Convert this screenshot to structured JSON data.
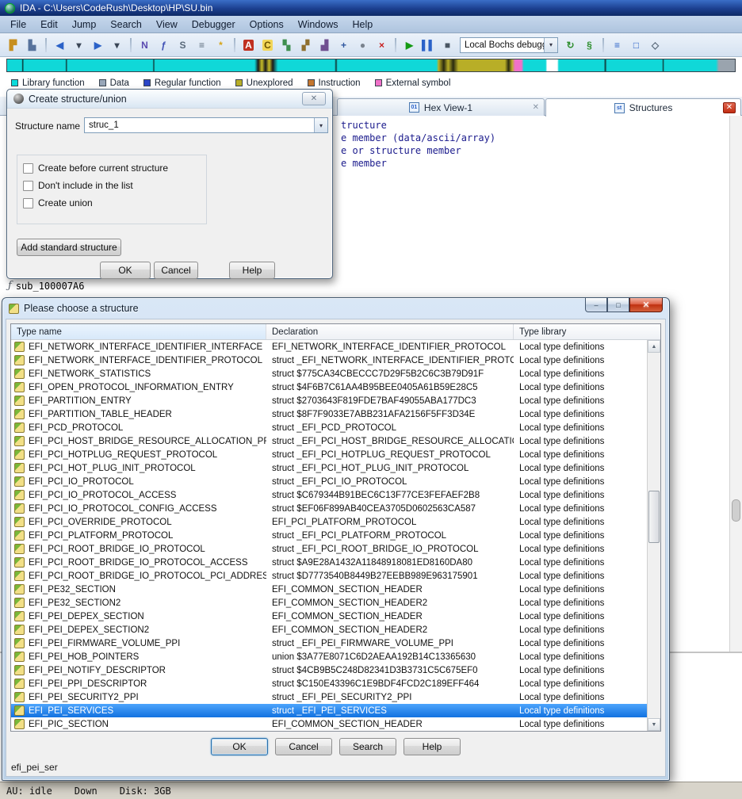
{
  "window": {
    "title": "IDA - C:\\Users\\CodeRush\\Desktop\\HP\\SU.bin"
  },
  "menubar": {
    "items": [
      "File",
      "Edit",
      "Jump",
      "Search",
      "View",
      "Debugger",
      "Options",
      "Windows",
      "Help"
    ]
  },
  "toolbar": {
    "debugger_combo": {
      "value": "Local Bochs debugger",
      "arrow": "▾"
    },
    "items_left": [
      {
        "name": "open-file-icon",
        "glyph": "▛",
        "color": "#c78f1f"
      },
      {
        "name": "save-icon",
        "glyph": "▙",
        "color": "#56729c"
      },
      {
        "name": "separator"
      },
      {
        "name": "navigate-back-icon",
        "glyph": "◀",
        "color": "#2b62c8"
      },
      {
        "name": "back-history-dropdown-icon",
        "glyph": "▾",
        "color": "#3a4656"
      },
      {
        "name": "navigate-forward-icon",
        "glyph": "▶",
        "color": "#2b62c8"
      },
      {
        "name": "forward-history-dropdown-icon",
        "glyph": "▾",
        "color": "#3a4656"
      },
      {
        "name": "separator"
      },
      {
        "name": "names-window-icon",
        "glyph": "N",
        "color": "#5a4ab0"
      },
      {
        "name": "functions-window-icon",
        "glyph": "ƒ",
        "color": "#3f51b5"
      },
      {
        "name": "strings-window-icon",
        "glyph": "S",
        "color": "#5a6a7a"
      },
      {
        "name": "segments-window-icon",
        "glyph": "≡",
        "color": "#5a6a7a"
      },
      {
        "name": "flashlight-icon",
        "glyph": "*",
        "color": "#d7a417"
      },
      {
        "name": "separator"
      },
      {
        "name": "bitmap-icon",
        "glyph": "A",
        "color": "#ffffff",
        "bg": "#c03020"
      },
      {
        "name": "compiler-icon",
        "glyph": "C",
        "color": "#6b5200",
        "bg": "#f2d659"
      },
      {
        "name": "flow-chart-icon",
        "glyph": "▚",
        "color": "#3f8f4f"
      },
      {
        "name": "graph-view-icon",
        "glyph": "▞",
        "color": "#8f6f2f"
      },
      {
        "name": "call-graph-icon",
        "glyph": "▟",
        "color": "#6f4f8f"
      },
      {
        "name": "new-window-icon",
        "glyph": "+",
        "color": "#30589f"
      },
      {
        "name": "snapshot-icon",
        "glyph": "●",
        "color": "#7a838e"
      },
      {
        "name": "delete-icon",
        "glyph": "×",
        "color": "#c81e1e"
      },
      {
        "name": "separator"
      },
      {
        "name": "start-process-icon",
        "glyph": "▶",
        "color": "#149a14"
      },
      {
        "name": "pause-process-icon",
        "glyph": "▌▌",
        "color": "#2b62c8"
      },
      {
        "name": "stop-process-icon",
        "glyph": "■",
        "color": "#4a5663"
      }
    ],
    "items_right": [
      {
        "name": "refresh-icon",
        "glyph": "↻",
        "color": "#2f8f2f"
      },
      {
        "name": "run-script-icon",
        "glyph": "§",
        "color": "#2f8f2f"
      },
      {
        "name": "separator"
      },
      {
        "name": "type-libraries-icon",
        "glyph": "≡",
        "color": "#2b62c8"
      },
      {
        "name": "structures-window-icon",
        "glyph": "□",
        "color": "#2b62c8"
      },
      {
        "name": "enums-window-icon",
        "glyph": "◇",
        "color": "#5a6a7a"
      }
    ]
  },
  "navband": {
    "legend": [
      {
        "label": "Library function",
        "color": "#0adbdb"
      },
      {
        "label": "Data",
        "color": "#98a6b8"
      },
      {
        "label": "Regular function",
        "color": "#2b46c8"
      },
      {
        "label": "Unexplored",
        "color": "#b8ae27"
      },
      {
        "label": "Instruction",
        "color": "#c4762e"
      },
      {
        "label": "External symbol",
        "color": "#f071c8"
      }
    ]
  },
  "tabs": {
    "hex": {
      "label": "Hex View-1",
      "icon_glyph": "01",
      "close_glyph": "✕"
    },
    "structures": {
      "label": "Structures",
      "icon_glyph": "st",
      "close_glyph": "✕"
    }
  },
  "structures_view": {
    "lines": [
      "tructure",
      "e member (data/ascii/array)",
      "e or structure member",
      "e member"
    ],
    "function_icon": "ƒ",
    "function_label": "sub_100007A6"
  },
  "create_dialog": {
    "title": "Create structure/union",
    "close_glyph": "✕",
    "name_label": "Structure name",
    "name_value": "struc_1",
    "name_arrow": "▾",
    "checkboxes": [
      "Create before current structure",
      "Don't include in the list",
      "Create union"
    ],
    "add_button": "Add standard structure",
    "buttons": [
      "OK",
      "Cancel",
      "Help"
    ]
  },
  "choose_dialog": {
    "title": "Please choose a structure",
    "window_buttons": {
      "minimize": "–",
      "maximize": "□",
      "close": "✕"
    },
    "columns": [
      "Type name",
      "Declaration",
      "Type library"
    ],
    "selected_index": 27,
    "rows": [
      {
        "type_name": "EFI_NETWORK_INTERFACE_IDENTIFIER_INTERFACE",
        "declaration": "EFI_NETWORK_INTERFACE_IDENTIFIER_PROTOCOL",
        "library": "Local type definitions"
      },
      {
        "type_name": "EFI_NETWORK_INTERFACE_IDENTIFIER_PROTOCOL",
        "declaration": "struct _EFI_NETWORK_INTERFACE_IDENTIFIER_PROTOC...",
        "library": "Local type definitions"
      },
      {
        "type_name": "EFI_NETWORK_STATISTICS",
        "declaration": "struct $775CA34CBECCC7D29F5B2C6C3B79D91F",
        "library": "Local type definitions"
      },
      {
        "type_name": "EFI_OPEN_PROTOCOL_INFORMATION_ENTRY",
        "declaration": "struct $4F6B7C61AA4B95BEE0405A61B59E28C5",
        "library": "Local type definitions"
      },
      {
        "type_name": "EFI_PARTITION_ENTRY",
        "declaration": "struct $2703643F819FDE7BAF49055ABA177DC3",
        "library": "Local type definitions"
      },
      {
        "type_name": "EFI_PARTITION_TABLE_HEADER",
        "declaration": "struct $8F7F9033E7ABB231AFA2156F5FF3D34E",
        "library": "Local type definitions"
      },
      {
        "type_name": "EFI_PCD_PROTOCOL",
        "declaration": "struct _EFI_PCD_PROTOCOL",
        "library": "Local type definitions"
      },
      {
        "type_name": "EFI_PCI_HOST_BRIDGE_RESOURCE_ALLOCATION_PROT...",
        "declaration": "struct _EFI_PCI_HOST_BRIDGE_RESOURCE_ALLOCATION...",
        "library": "Local type definitions"
      },
      {
        "type_name": "EFI_PCI_HOTPLUG_REQUEST_PROTOCOL",
        "declaration": "struct _EFI_PCI_HOTPLUG_REQUEST_PROTOCOL",
        "library": "Local type definitions"
      },
      {
        "type_name": "EFI_PCI_HOT_PLUG_INIT_PROTOCOL",
        "declaration": "struct _EFI_PCI_HOT_PLUG_INIT_PROTOCOL",
        "library": "Local type definitions"
      },
      {
        "type_name": "EFI_PCI_IO_PROTOCOL",
        "declaration": "struct _EFI_PCI_IO_PROTOCOL",
        "library": "Local type definitions"
      },
      {
        "type_name": "EFI_PCI_IO_PROTOCOL_ACCESS",
        "declaration": "struct $C679344B91BEC6C13F77CE3FEFAEF2B8",
        "library": "Local type definitions"
      },
      {
        "type_name": "EFI_PCI_IO_PROTOCOL_CONFIG_ACCESS",
        "declaration": "struct $EF06F899AB40CEA3705D0602563CA587",
        "library": "Local type definitions"
      },
      {
        "type_name": "EFI_PCI_OVERRIDE_PROTOCOL",
        "declaration": "EFI_PCI_PLATFORM_PROTOCOL",
        "library": "Local type definitions"
      },
      {
        "type_name": "EFI_PCI_PLATFORM_PROTOCOL",
        "declaration": "struct _EFI_PCI_PLATFORM_PROTOCOL",
        "library": "Local type definitions"
      },
      {
        "type_name": "EFI_PCI_ROOT_BRIDGE_IO_PROTOCOL",
        "declaration": "struct _EFI_PCI_ROOT_BRIDGE_IO_PROTOCOL",
        "library": "Local type definitions"
      },
      {
        "type_name": "EFI_PCI_ROOT_BRIDGE_IO_PROTOCOL_ACCESS",
        "declaration": "struct $A9E28A1432A11848918081ED8160DA80",
        "library": "Local type definitions"
      },
      {
        "type_name": "EFI_PCI_ROOT_BRIDGE_IO_PROTOCOL_PCI_ADDRESS",
        "declaration": "struct $D7773540B8449B27EEBB989E963175901",
        "library": "Local type definitions"
      },
      {
        "type_name": "EFI_PE32_SECTION",
        "declaration": "EFI_COMMON_SECTION_HEADER",
        "library": "Local type definitions"
      },
      {
        "type_name": "EFI_PE32_SECTION2",
        "declaration": "EFI_COMMON_SECTION_HEADER2",
        "library": "Local type definitions"
      },
      {
        "type_name": "EFI_PEI_DEPEX_SECTION",
        "declaration": "EFI_COMMON_SECTION_HEADER",
        "library": "Local type definitions"
      },
      {
        "type_name": "EFI_PEI_DEPEX_SECTION2",
        "declaration": "EFI_COMMON_SECTION_HEADER2",
        "library": "Local type definitions"
      },
      {
        "type_name": "EFI_PEI_FIRMWARE_VOLUME_PPI",
        "declaration": "struct _EFI_PEI_FIRMWARE_VOLUME_PPI",
        "library": "Local type definitions"
      },
      {
        "type_name": "EFI_PEI_HOB_POINTERS",
        "declaration": "union $3A77E8071C6D2AEAA192B14C13365630",
        "library": "Local type definitions"
      },
      {
        "type_name": "EFI_PEI_NOTIFY_DESCRIPTOR",
        "declaration": "struct $4CB9B5C248D82341D3B3731C5C675EF0",
        "library": "Local type definitions"
      },
      {
        "type_name": "EFI_PEI_PPI_DESCRIPTOR",
        "declaration": "struct $C150E43396C1E9BDF4FCD2C189EFF464",
        "library": "Local type definitions"
      },
      {
        "type_name": "EFI_PEI_SECURITY2_PPI",
        "declaration": "struct _EFI_PEI_SECURITY2_PPI",
        "library": "Local type definitions"
      },
      {
        "type_name": "EFI_PEI_SERVICES",
        "declaration": "struct _EFI_PEI_SERVICES",
        "library": "Local type definitions"
      },
      {
        "type_name": "EFI_PIC_SECTION",
        "declaration": "EFI_COMMON_SECTION_HEADER",
        "library": "Local type definitions"
      }
    ],
    "buttons": [
      "OK",
      "Cancel",
      "Search",
      "Help"
    ],
    "filter_text": "efi_pei_ser"
  },
  "statusbar": {
    "au": "AU: idle",
    "down": "Down",
    "disk": "Disk: 3GB"
  }
}
